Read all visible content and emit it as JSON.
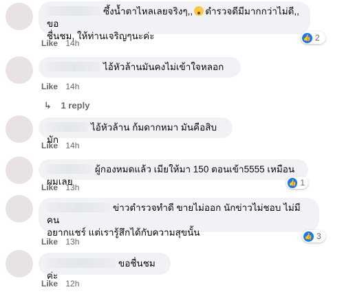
{
  "comments": [
    {
      "text_line1": "ซึ้งน้ำตาไหลเลยจริงๆ,,",
      "text_line1b": "ตำรวจดีมีมากกว่าไม่ดี,, ขอ",
      "text_line2": "ชื่นชม, ให้ท่านเจริญๆนะค่ะ",
      "like": "Like",
      "time": "14h",
      "reactions": "2",
      "emoji_icon": "crying-face-icon"
    },
    {
      "text_line1": "ไอ้หัวล้านมันคงไม่เข้าใจหลอก",
      "like": "Like",
      "time": "14h",
      "reply": "1 reply"
    },
    {
      "text_line1": "ไอ้หัวล้าน ก้มดากหมา มันคือสิบมัก",
      "like": "Like",
      "time": "14h"
    },
    {
      "text_line1": "ผู้กองหมดแล้ว เมียให้มา 150 ตอนเข้า5555 เหมือนผมเลย",
      "like": "Like",
      "time": "13h",
      "reactions": "1"
    },
    {
      "text_line1": "ข่าวตำรวจทำดี ขายไม่ออก นักข่าวไม่ชอบ ไม่มีคน",
      "text_line2": "อยากแชร์ แต่เรารู้สึกได้กับความสุขนั้น",
      "like": "Like",
      "time": "13h",
      "reactions": "3"
    },
    {
      "text_line1": "ขอชื่นชมค่ะ",
      "like": "Like",
      "time": "12h"
    }
  ],
  "icons": {
    "like_reaction": "thumbs-up-icon",
    "reply": "reply-arrow-icon"
  },
  "colors": {
    "bubble": "#f0f2f5",
    "meta": "#65676b",
    "like_blue": "#1877f2"
  }
}
